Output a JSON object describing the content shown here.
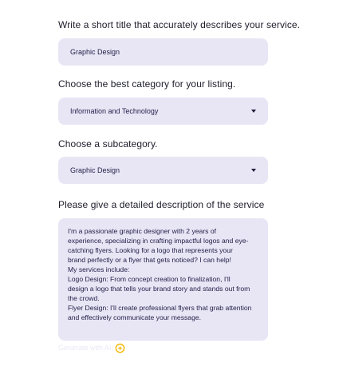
{
  "form": {
    "title_section": {
      "label": "Write a short title that accurately describes your service.",
      "value": "Graphic Design"
    },
    "category_section": {
      "label": "Choose the best category for your listing.",
      "selected": "Information and Technology"
    },
    "subcategory_section": {
      "label": "Choose a subcategory.",
      "selected": "Graphic Design"
    },
    "description_section": {
      "label": "Please give a detailed description of the service",
      "lines": [
        "I'm a passionate graphic designer with 2 years of",
        "experience, specializing in crafting impactful logos and eye-",
        "catching flyers. Looking for a logo that represents your",
        "brand perfectly or a flyer that gets noticed? I can help!",
        "My services include:",
        "Logo Design: From concept creation to finalization, I'll",
        "design a logo that tells your brand story and stands out from",
        "the crowd.",
        "Flyer Design: I'll create professional flyers that grab attention",
        "and effectively communicate your message."
      ]
    },
    "ai_button": {
      "label": "Generate with AI",
      "icon": "sparkle-icon",
      "icon_color": "#f2b705"
    }
  },
  "colors": {
    "field_background": "#e8e6f5",
    "text": "#24204a"
  }
}
